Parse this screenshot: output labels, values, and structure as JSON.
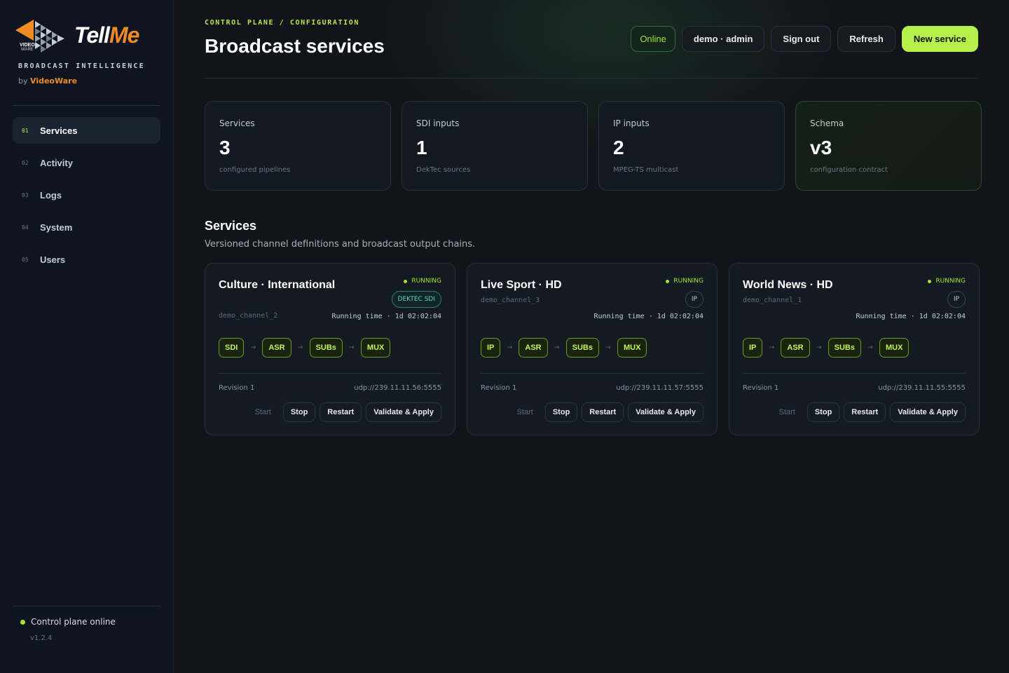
{
  "brand": {
    "logo_text_1": "Tell",
    "logo_text_2": "Me",
    "logo_mark_text_1": "VIDEO",
    "logo_mark_text_2": "WARE",
    "tagline": "BROADCAST INTELLIGENCE",
    "by": "by",
    "company": "VideoWare",
    "accent": "#f08a24"
  },
  "sidebar": {
    "items": [
      {
        "num": "01",
        "label": "Services",
        "active": true
      },
      {
        "num": "02",
        "label": "Activity",
        "active": false
      },
      {
        "num": "03",
        "label": "Logs",
        "active": false
      },
      {
        "num": "04",
        "label": "System",
        "active": false
      },
      {
        "num": "05",
        "label": "Users",
        "active": false
      }
    ],
    "status_text": "Control plane online",
    "version": "v1.2.4"
  },
  "header": {
    "eyebrow": "CONTROL PLANE / CONFIGURATION",
    "title": "Broadcast services",
    "online": "Online",
    "user": "demo · admin",
    "sign_out": "Sign out",
    "refresh": "Refresh",
    "new_service": "New service"
  },
  "stats": [
    {
      "label": "Services",
      "value": "3",
      "sub": "configured pipelines"
    },
    {
      "label": "SDI inputs",
      "value": "1",
      "sub": "DekTec sources"
    },
    {
      "label": "IP inputs",
      "value": "2",
      "sub": "MPEG-TS multicast"
    },
    {
      "label": "Schema",
      "value": "v3",
      "sub": "configuration contract"
    }
  ],
  "section": {
    "title": "Services",
    "subtitle": "Versioned channel definitions and broadcast output chains."
  },
  "services": [
    {
      "title": "Culture · International",
      "channel": "demo_channel_2",
      "status": "RUNNING",
      "badge": "DEKTEC SDI",
      "runtime": "Running time · 1d 02:02:04",
      "chain": [
        "SDI",
        "ASR",
        "SUBs",
        "MUX"
      ],
      "revision": "Revision 1",
      "output": "udp://239.11.11.56:5555",
      "actions": {
        "start": "Start",
        "stop": "Stop",
        "restart": "Restart",
        "apply": "Validate & Apply"
      }
    },
    {
      "title": "Live Sport · HD",
      "channel": "demo_channel_3",
      "status": "RUNNING",
      "badge": "IP",
      "runtime": "Running time · 1d 02:02:04",
      "chain": [
        "IP",
        "ASR",
        "SUBs",
        "MUX"
      ],
      "revision": "Revision 1",
      "output": "udp://239.11.11.57:5555",
      "actions": {
        "start": "Start",
        "stop": "Stop",
        "restart": "Restart",
        "apply": "Validate & Apply"
      }
    },
    {
      "title": "World News · HD",
      "channel": "demo_channel_1",
      "status": "RUNNING",
      "badge": "IP",
      "runtime": "Running time · 1d 02:02:04",
      "chain": [
        "IP",
        "ASR",
        "SUBs",
        "MUX"
      ],
      "revision": "Revision 1",
      "output": "udp://239.11.11.55:5555",
      "actions": {
        "start": "Start",
        "stop": "Stop",
        "restart": "Restart",
        "apply": "Validate & Apply"
      }
    }
  ],
  "icons": {
    "logo": "videoware-play-mark-icon",
    "chain_arrow": "→",
    "status_dot": "status-dot-icon"
  }
}
